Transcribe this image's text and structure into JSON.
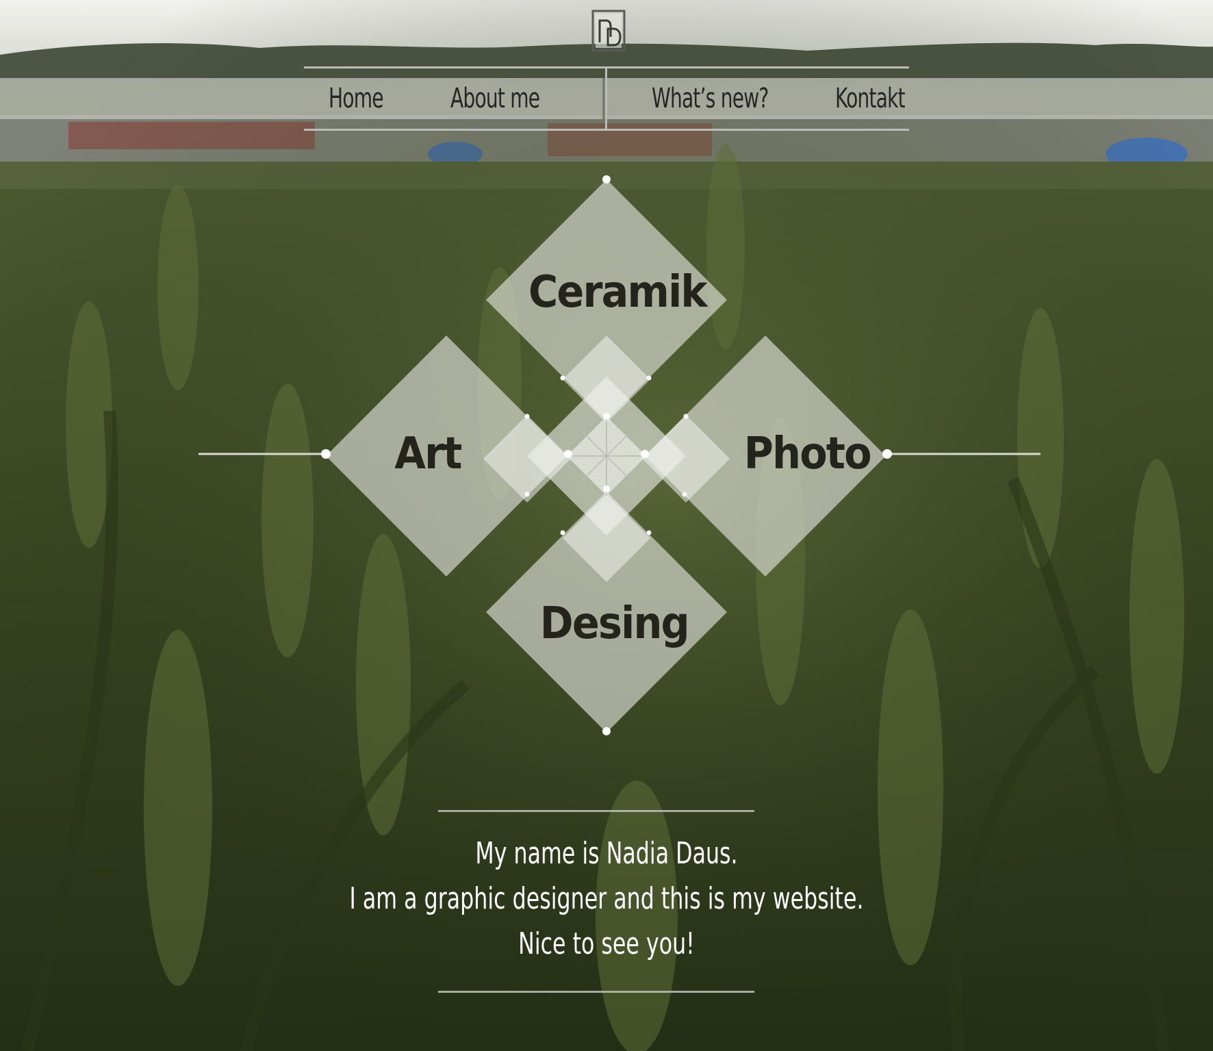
{
  "brand": {
    "logo_text": "ND",
    "logo_icon": "monogram-logo-icon"
  },
  "nav": {
    "items": [
      {
        "label": "Home"
      },
      {
        "label": "About me"
      },
      {
        "label": "What’s new?"
      },
      {
        "label": "Kontakt"
      }
    ]
  },
  "categories": [
    {
      "label": "Ceramik"
    },
    {
      "label": "Art"
    },
    {
      "label": "Photo"
    },
    {
      "label": "Desing"
    }
  ],
  "intro": {
    "lines": [
      "My name is Nadia Daus.",
      "I am a graphic designer and this is my website.",
      "Nice to see you!"
    ]
  },
  "colors": {
    "nav_band": "#c8c8c4",
    "tile_fill": "#e6e6e2",
    "label_dark": "#24231c",
    "intro_text": "#ffffff",
    "field_green": "#3e4a28"
  },
  "background": {
    "scene": "wheat-field-photo"
  }
}
